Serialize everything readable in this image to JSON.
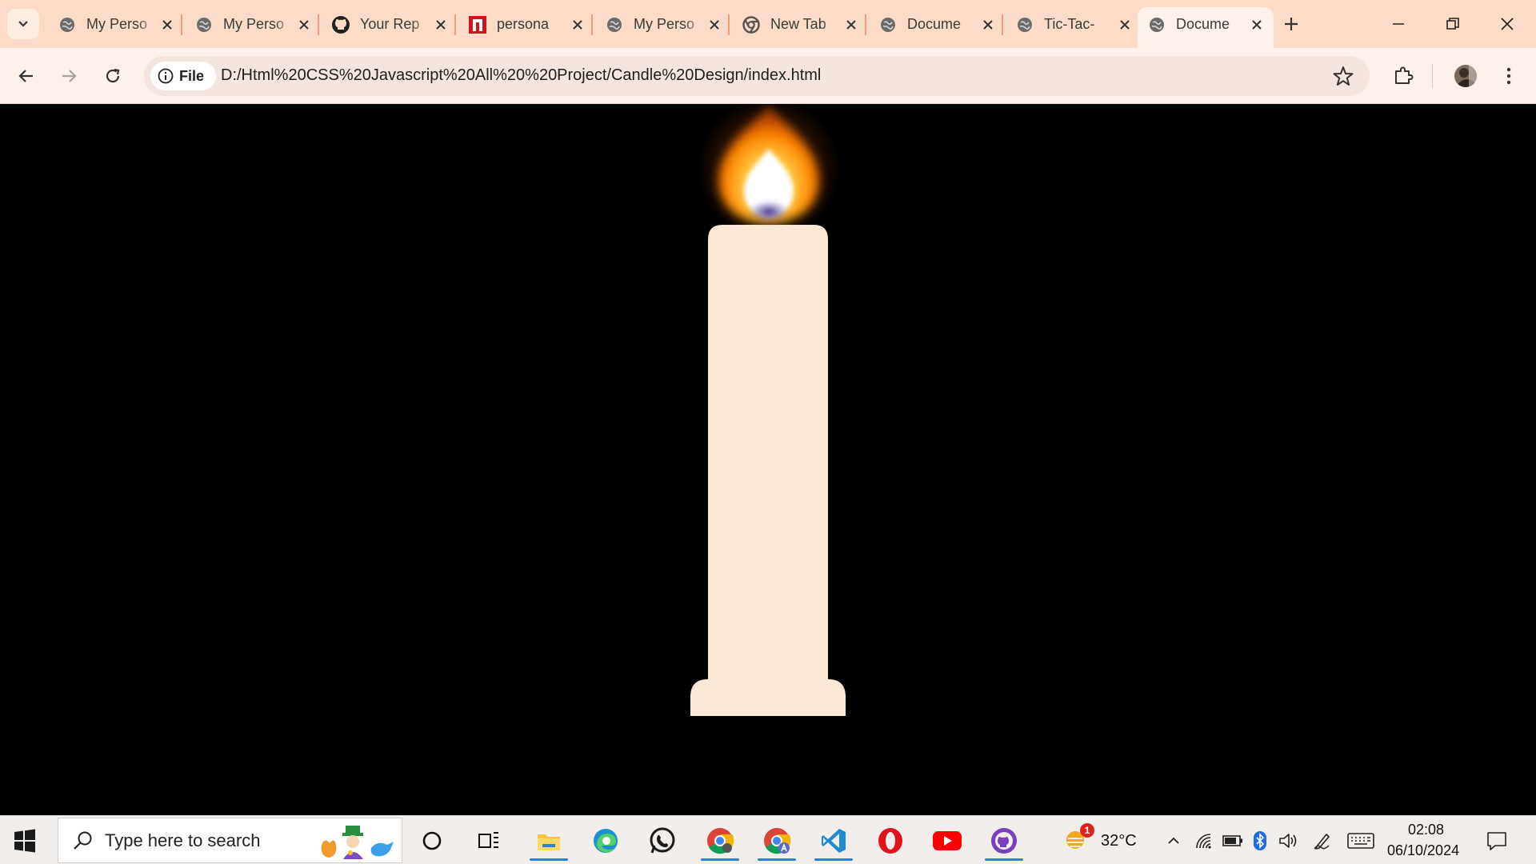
{
  "browser": {
    "tabs": [
      {
        "title": "My Perso",
        "favicon": "globe-icon"
      },
      {
        "title": "My Perso",
        "favicon": "globe-icon"
      },
      {
        "title": "Your Rep",
        "favicon": "github-icon"
      },
      {
        "title": "persona",
        "favicon": "red-n-icon"
      },
      {
        "title": "My Perso",
        "favicon": "globe-icon"
      },
      {
        "title": "New Tab",
        "favicon": "chrome-icon"
      },
      {
        "title": "Docume",
        "favicon": "globe-icon"
      },
      {
        "title": "Tic-Tac-",
        "favicon": "globe-icon"
      },
      {
        "title": "Docume",
        "favicon": "globe-icon",
        "active": true
      }
    ],
    "site_chip": "File",
    "url": "D:/Html%20CSS%20Javascript%20All%20%20Project/Candle%20Design/index.html"
  },
  "page": {
    "colors": {
      "background": "#000000",
      "candle_wax": "#fbe9d5",
      "flame_outer": "#ff8a00",
      "flame_core": "#ffffff",
      "flame_base": "#5a4fa8"
    }
  },
  "taskbar": {
    "search_placeholder": "Type here to search",
    "weather": "32°C",
    "weather_badge": "1",
    "time": "02:08",
    "date": "06/10/2024",
    "pinned": [
      "cortana-circle-icon",
      "task-view-icon",
      "file-explorer-icon",
      "edge-icon",
      "whatsapp-icon",
      "chrome-icon",
      "chrome-profile-icon",
      "vscode-icon",
      "opera-icon",
      "youtube-icon",
      "github-desktop-icon"
    ]
  },
  "colors": {
    "tabstrip": "#fcdcc8",
    "toolbar": "#fdf1ec",
    "taskbar": "#f1eeec",
    "accent": "#2f7fd8"
  }
}
